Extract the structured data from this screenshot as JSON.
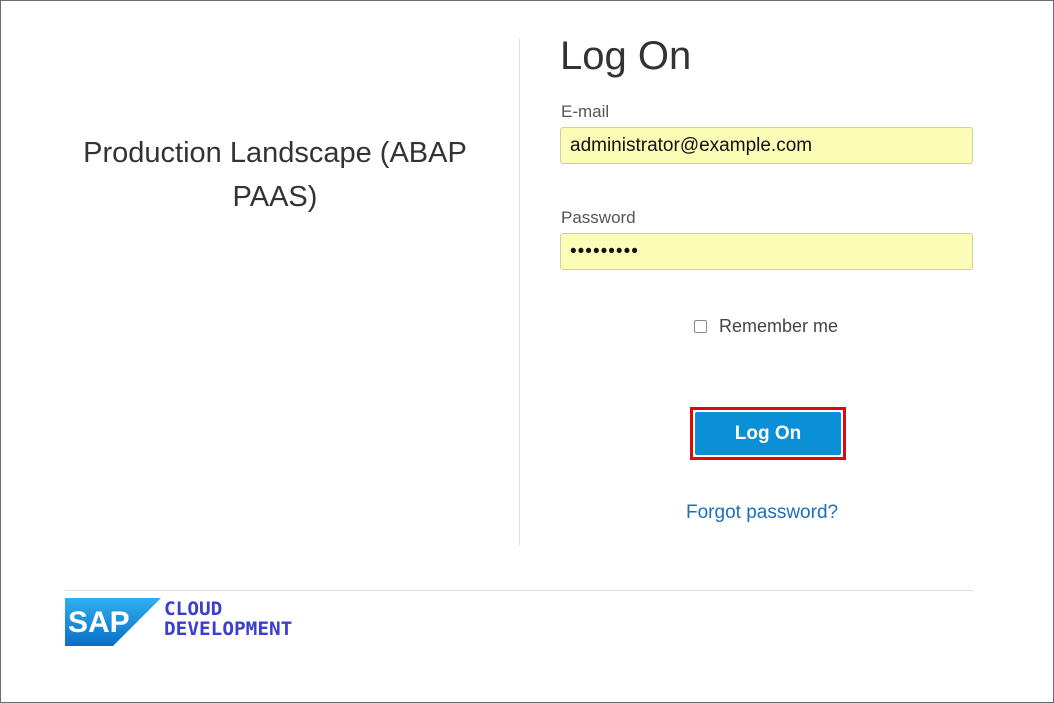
{
  "landscape": {
    "title": "Production Landscape (ABAP PAAS)"
  },
  "logon": {
    "heading": "Log On",
    "email_label": "E-mail",
    "email_value": "administrator@example.com",
    "password_label": "Password",
    "password_value": "•••••••••",
    "remember_label": "Remember me",
    "remember_checked": false,
    "button_label": "Log On",
    "forgot_label": "Forgot password?"
  },
  "footer": {
    "logo_brand": "SAP",
    "logo_line1": "CLOUD",
    "logo_line2": "DEVELOPMENT"
  },
  "colors": {
    "field_fill": "#fbfdb7",
    "button_blue": "#0b8fd6",
    "highlight_red": "#e10a0a",
    "link_blue": "#1b6fbd",
    "logo_text": "#3a3fd0"
  }
}
